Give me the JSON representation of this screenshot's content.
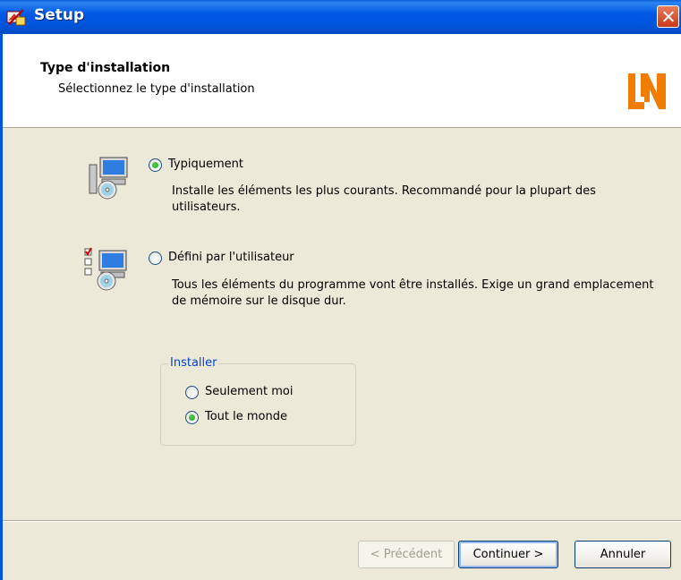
{
  "window": {
    "title": "Setup"
  },
  "header": {
    "title": "Type d'installation",
    "subtitle": "Sélectionnez le type d'installation"
  },
  "options": [
    {
      "label": "Typiquement",
      "description": "Installe les éléments les plus courants. Recommandé pour la plupart des utilisateurs.",
      "selected": true,
      "icon": "typical-install-icon"
    },
    {
      "label": "Défini par l'utilisateur",
      "description": "Tous les éléments du programme vont être installés. Exige un grand emplacement de mémoire sur le disque dur.",
      "selected": false,
      "icon": "custom-install-icon"
    }
  ],
  "install_for": {
    "legend": "Installer",
    "options": [
      {
        "label": "Seulement moi",
        "selected": false
      },
      {
        "label": "Tout le monde",
        "selected": true
      }
    ]
  },
  "buttons": {
    "back": "< Précédent",
    "next": "Continuer >",
    "cancel": "Annuler"
  },
  "colors": {
    "titlebar": "#0055DD",
    "logo": "#F07D00",
    "legend": "#0046D5"
  }
}
